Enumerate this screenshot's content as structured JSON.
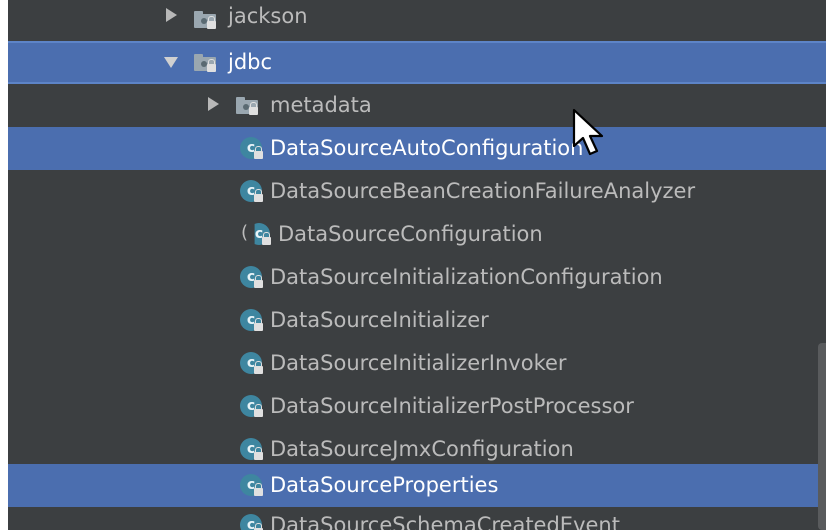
{
  "tree": {
    "packages": {
      "jackson": "jackson",
      "jdbc": "jdbc",
      "metadata": "metadata"
    },
    "classes": [
      "DataSourceAutoConfiguration",
      "DataSourceBeanCreationFailureAnalyzer",
      "DataSourceConfiguration",
      "DataSourceInitializationConfiguration",
      "DataSourceInitializer",
      "DataSourceInitializerInvoker",
      "DataSourceInitializerPostProcessor",
      "DataSourceJmxConfiguration",
      "DataSourceProperties",
      "DataSourceSchemaCreatedEvent"
    ],
    "class_icon_letter": "c"
  },
  "colors": {
    "panel_background": "#3c3f41",
    "selection": "#4b6eaf",
    "text": "#bbbbbb",
    "class_icon": "#3e86a0"
  },
  "icons": {
    "expanded_arrow": "chevron-down-icon",
    "collapsed_arrow": "chevron-right-icon",
    "package": "package-folder-icon",
    "class": "class-icon",
    "lock": "lock-icon"
  }
}
